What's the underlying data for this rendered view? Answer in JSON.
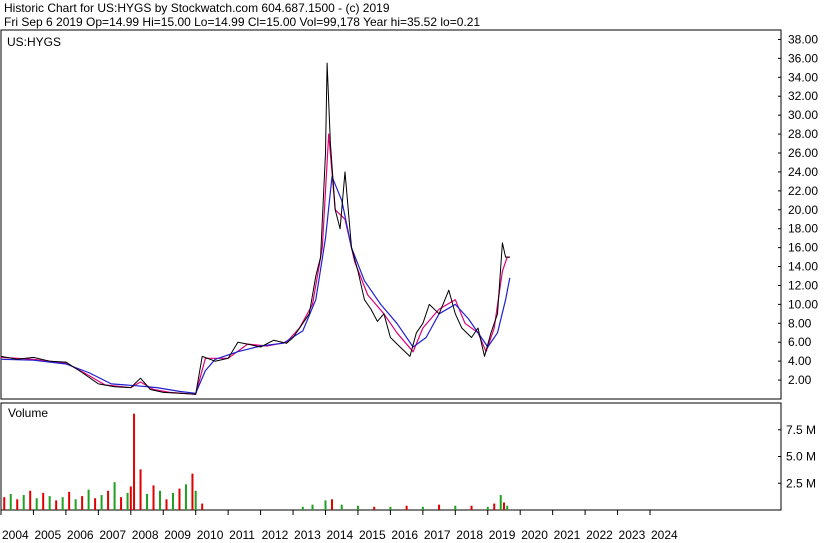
{
  "header": {
    "line1": "Historic Chart for US:HYGS by Stockwatch.com 604.687.1500 - (c) 2019",
    "line2": "Fri Sep  6 2019  Op=14.99  Hi=15.00  Lo=14.99  Cl=15.00  Vol=99,178  Year hi=35.52  lo=0.21"
  },
  "chart_data": {
    "type": "line",
    "symbol_label": "US:HYGS",
    "volume_label": "Volume",
    "x_ticks": [
      "2004",
      "2005",
      "2006",
      "2007",
      "2008",
      "2009",
      "2010",
      "2011",
      "2012",
      "2013",
      "2014",
      "2015",
      "2016",
      "2017",
      "2018",
      "2019",
      "2020",
      "2021",
      "2022",
      "2023",
      "2024"
    ],
    "price_axis": {
      "ticks": [
        "38.00",
        "36.00",
        "34.00",
        "32.00",
        "30.00",
        "28.00",
        "26.00",
        "24.00",
        "22.00",
        "20.00",
        "18.00",
        "16.00",
        "14.00",
        "12.00",
        "10.00",
        "8.00",
        "6.00",
        "4.00",
        "2.00"
      ],
      "ylim": [
        0,
        39
      ]
    },
    "volume_axis": {
      "ticks": [
        "7.5 M",
        "5.0 M",
        "2.5 M"
      ],
      "ylim": [
        0,
        10
      ]
    },
    "price_series": {
      "name": "US:HYGS",
      "color": "#000000",
      "x": [
        2004.0,
        2004.5,
        2005.0,
        2005.5,
        2006.0,
        2006.5,
        2007.0,
        2007.5,
        2008.0,
        2008.3,
        2008.6,
        2009.0,
        2009.5,
        2010.0,
        2010.2,
        2010.6,
        2011.0,
        2011.3,
        2011.6,
        2012.0,
        2012.4,
        2012.8,
        2013.0,
        2013.3,
        2013.5,
        2013.7,
        2013.85,
        2014.0,
        2014.05,
        2014.15,
        2014.3,
        2014.45,
        2014.6,
        2014.8,
        2015.0,
        2015.2,
        2015.4,
        2015.6,
        2015.8,
        2016.0,
        2016.3,
        2016.6,
        2016.8,
        2017.0,
        2017.2,
        2017.5,
        2017.8,
        2018.0,
        2018.2,
        2018.5,
        2018.7,
        2018.9,
        2019.1,
        2019.3,
        2019.45,
        2019.55,
        2019.68
      ],
      "values": [
        4.5,
        4.2,
        4.4,
        4.0,
        3.9,
        2.8,
        1.6,
        1.3,
        1.2,
        2.2,
        1.0,
        0.7,
        0.6,
        0.5,
        4.5,
        4.0,
        4.3,
        6.0,
        5.8,
        5.5,
        6.2,
        5.9,
        6.5,
        8.0,
        9.0,
        13.0,
        15.0,
        26.0,
        35.5,
        27.0,
        20.0,
        18.0,
        24.0,
        16.0,
        13.5,
        10.5,
        9.5,
        8.2,
        9.0,
        6.5,
        5.5,
        4.5,
        7.0,
        8.0,
        10.0,
        9.0,
        11.5,
        9.0,
        7.5,
        6.5,
        7.5,
        4.5,
        7.0,
        9.0,
        16.5,
        15.0,
        15.0
      ]
    },
    "moving_averages": [
      {
        "color": "#e0007a",
        "x": [
          2004.0,
          2005.0,
          2006.0,
          2006.6,
          2007.2,
          2008.0,
          2008.3,
          2008.7,
          2009.2,
          2010.0,
          2010.3,
          2011.0,
          2011.6,
          2012.2,
          2012.8,
          2013.2,
          2013.6,
          2013.9,
          2014.1,
          2014.3,
          2014.6,
          2014.9,
          2015.3,
          2015.8,
          2016.2,
          2016.7,
          2017.0,
          2017.5,
          2018.0,
          2018.3,
          2018.7,
          2018.95,
          2019.2,
          2019.45,
          2019.6,
          2019.68
        ],
        "values": [
          4.4,
          4.2,
          3.8,
          2.7,
          1.5,
          1.2,
          1.8,
          1.0,
          0.7,
          0.5,
          4.3,
          4.3,
          5.8,
          5.6,
          6.0,
          7.5,
          10.0,
          16.0,
          28.0,
          20.0,
          19.0,
          14.5,
          11.0,
          9.0,
          7.0,
          5.0,
          7.5,
          9.5,
          10.5,
          8.0,
          7.0,
          5.0,
          7.5,
          13.5,
          15.0,
          15.0
        ]
      },
      {
        "color": "#2020d0",
        "x": [
          2004.0,
          2005.0,
          2006.0,
          2006.7,
          2007.4,
          2008.2,
          2008.8,
          2009.5,
          2010.0,
          2010.3,
          2010.6,
          2011.3,
          2012.0,
          2012.7,
          2013.3,
          2013.7,
          2014.0,
          2014.2,
          2014.5,
          2014.8,
          2015.2,
          2015.7,
          2016.2,
          2016.7,
          2017.1,
          2017.5,
          2018.0,
          2018.4,
          2018.8,
          2019.0,
          2019.3,
          2019.55,
          2019.68
        ],
        "values": [
          4.2,
          4.1,
          3.7,
          2.8,
          1.6,
          1.4,
          1.2,
          0.8,
          0.6,
          3.0,
          4.2,
          5.0,
          5.6,
          5.9,
          7.2,
          10.5,
          17.0,
          23.5,
          21.0,
          16.0,
          12.5,
          10.0,
          8.0,
          5.5,
          6.5,
          9.0,
          10.0,
          8.5,
          6.5,
          5.5,
          7.0,
          10.5,
          12.8
        ]
      }
    ],
    "volume_series": {
      "name": "Volume",
      "color_up": "#20a020",
      "color_down": "#e00000",
      "x": [
        2004.1,
        2004.3,
        2004.5,
        2004.7,
        2004.9,
        2005.1,
        2005.3,
        2005.5,
        2005.7,
        2005.9,
        2006.1,
        2006.3,
        2006.5,
        2006.7,
        2006.9,
        2007.1,
        2007.3,
        2007.5,
        2007.7,
        2007.9,
        2008.0,
        2008.1,
        2008.3,
        2008.5,
        2008.7,
        2008.9,
        2009.1,
        2009.3,
        2009.5,
        2009.7,
        2009.9,
        2010.0,
        2010.2,
        2013.3,
        2013.6,
        2014.0,
        2014.2,
        2014.5,
        2015.0,
        2015.5,
        2016.0,
        2016.5,
        2017.0,
        2017.5,
        2018.0,
        2018.5,
        2019.0,
        2019.2,
        2019.4,
        2019.5,
        2019.6
      ],
      "values": [
        1.2,
        1.5,
        1.0,
        1.4,
        1.8,
        1.1,
        1.6,
        1.3,
        0.9,
        1.2,
        1.7,
        1.0,
        1.3,
        1.9,
        1.1,
        1.4,
        1.8,
        2.6,
        1.2,
        1.6,
        2.2,
        9.0,
        3.8,
        1.5,
        2.3,
        1.8,
        1.0,
        1.6,
        2.0,
        2.4,
        3.4,
        1.8,
        0.6,
        0.3,
        0.5,
        0.9,
        1.0,
        0.5,
        0.4,
        0.3,
        0.3,
        0.4,
        0.3,
        0.5,
        0.4,
        0.4,
        0.3,
        0.6,
        1.4,
        0.7,
        0.4
      ],
      "up": [
        false,
        true,
        false,
        true,
        false,
        true,
        false,
        true,
        false,
        true,
        false,
        true,
        false,
        true,
        false,
        true,
        false,
        true,
        false,
        true,
        false,
        false,
        false,
        true,
        false,
        true,
        false,
        true,
        false,
        true,
        false,
        true,
        false,
        true,
        true,
        true,
        false,
        true,
        true,
        false,
        true,
        false,
        true,
        false,
        true,
        false,
        true,
        false,
        true,
        false,
        true
      ]
    }
  }
}
